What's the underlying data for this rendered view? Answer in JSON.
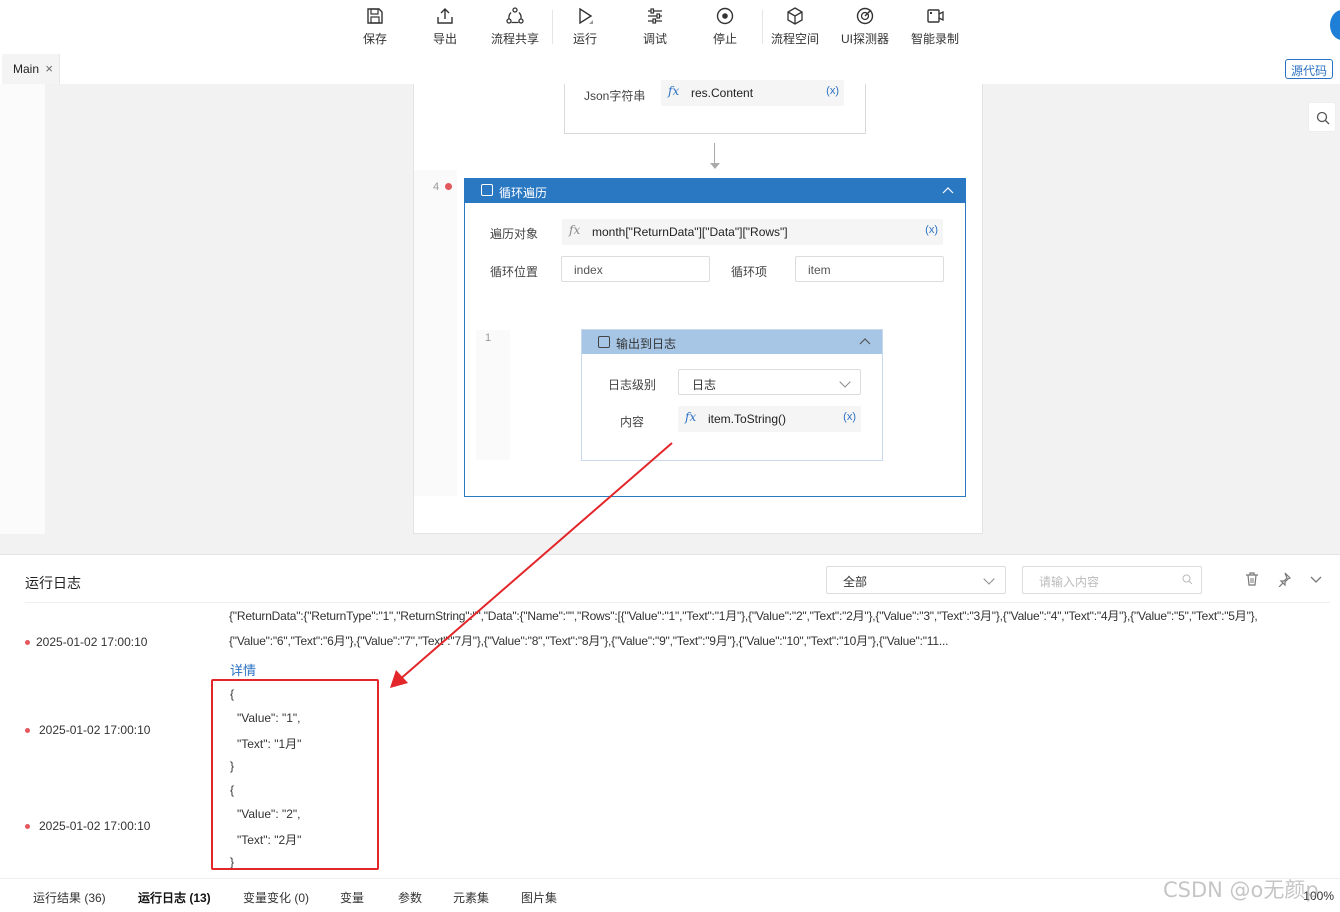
{
  "toolbar": {
    "save": "保存",
    "export": "导出",
    "share": "流程共享",
    "run": "运行",
    "debug": "调试",
    "stop": "停止",
    "space": "流程空间",
    "ui_probe": "UI探测器",
    "record": "智能录制"
  },
  "tabs": {
    "main": "Main",
    "close": "×",
    "source_code": "源代码"
  },
  "editor": {
    "json_label": "Json字符串",
    "json_value": "res.Content",
    "var_token": "(x)",
    "fx": "fx",
    "line4": "4",
    "line1": "1",
    "loop": {
      "title": "循环遍历",
      "iter_obj_label": "遍历对象",
      "iter_obj_value": "month[\"ReturnData\"][\"Data\"][\"Rows\"]",
      "pos_label": "循环位置",
      "pos_value": "index",
      "item_label": "循环项",
      "item_value": "item"
    },
    "log": {
      "title": "输出到日志",
      "level_label": "日志级别",
      "level_value": "日志",
      "content_label": "内容",
      "content_value": "item.ToString()"
    }
  },
  "panel": {
    "title": "运行日志",
    "filter_value": "全部",
    "search_placeholder": "请输入内容",
    "rows": [
      {
        "time": "2025-01-02 17:00:10"
      },
      {
        "time": "2025-01-02 17:00:10"
      },
      {
        "time": "2025-01-02 17:00:10"
      }
    ],
    "log_text_1": "{\"ReturnData\":{\"ReturnType\":\"1\",\"ReturnString\":\"\",\"Data\":{\"Name\":\"\",\"Rows\":[{\"Value\":\"1\",\"Text\":\"1月\"},{\"Value\":\"2\",\"Text\":\"2月\"},{\"Value\":\"3\",\"Text\":\"3月\"},{\"Value\":\"4\",\"Text\":\"4月\"},{\"Value\":\"5\",\"Text\":\"5月\"},",
    "log_text_2": "{\"Value\":\"6\",\"Text\":\"6月\"},{\"Value\":\"7\",\"Text\":\"7月\"},{\"Value\":\"8\",\"Text\":\"8月\"},{\"Value\":\"9\",\"Text\":\"9月\"},{\"Value\":\"10\",\"Text\":\"10月\"},{\"Value\":\"11...",
    "detail": "详情",
    "json_lines": [
      "{",
      "  \"Value\": \"1\",",
      "  \"Text\": \"1月\"",
      "}",
      "{",
      "  \"Value\": \"2\",",
      "  \"Text\": \"2月\"",
      "}"
    ]
  },
  "bottom_tabs": {
    "result": "运行结果 (36)",
    "log": "运行日志 (13)",
    "vars_change": "变量变化 (0)",
    "vars": "变量",
    "params": "参数",
    "elements": "元素集",
    "images": "图片集",
    "zoom": "100%"
  },
  "watermark": "CSDN @o无颜p",
  "colors": {
    "accent": "#2b78c2",
    "breakpoint": "#e2585d",
    "annotation": "#e2262a"
  }
}
